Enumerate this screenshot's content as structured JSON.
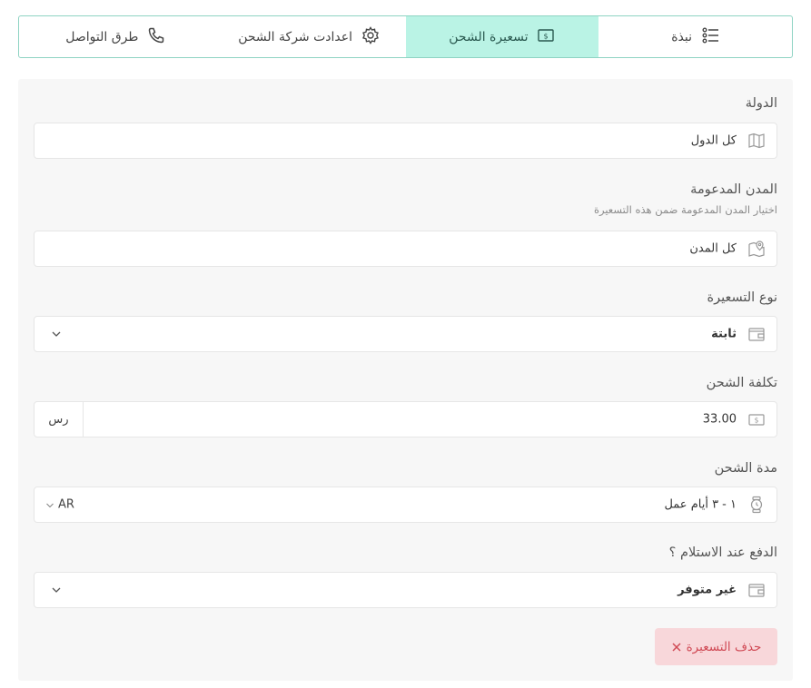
{
  "tabs": [
    {
      "label": "نبذة",
      "icon": "list-icon",
      "active": false
    },
    {
      "label": "تسعيرة الشحن",
      "icon": "money-icon",
      "active": true
    },
    {
      "label": "اعدادت شركة الشحن",
      "icon": "gear-icon",
      "active": false
    },
    {
      "label": "طرق التواصل",
      "icon": "phone-icon",
      "active": false
    }
  ],
  "form": {
    "country": {
      "label": "الدولة",
      "value": "كل الدول",
      "icon": "map-icon"
    },
    "cities": {
      "label": "المدن المدعومة",
      "hint": "اختيار المدن المدعومة ضمن هذه التسعيرة",
      "value": "كل المدن",
      "icon": "map-pin-icon"
    },
    "pricing_type": {
      "label": "نوع التسعيرة",
      "value": "ثابتة",
      "icon": "wallet-icon"
    },
    "shipping_cost": {
      "label": "تكلفة الشحن",
      "value": "33.00",
      "unit": "رس",
      "icon": "cash-icon"
    },
    "shipping_duration": {
      "label": "مدة الشحن",
      "value": "١ - ٣ أيام عمل",
      "lang": "AR",
      "icon": "watch-icon"
    },
    "cod": {
      "label": "الدفع عند الاستلام ؟",
      "value": "غير متوفر",
      "icon": "wallet-icon"
    }
  },
  "actions": {
    "delete_label": "حذف التسعيرة"
  },
  "colors": {
    "accent": "#baf3e5",
    "border": "#8fd3c3",
    "danger_bg": "#f8d7da",
    "danger_text": "#d04a55"
  }
}
